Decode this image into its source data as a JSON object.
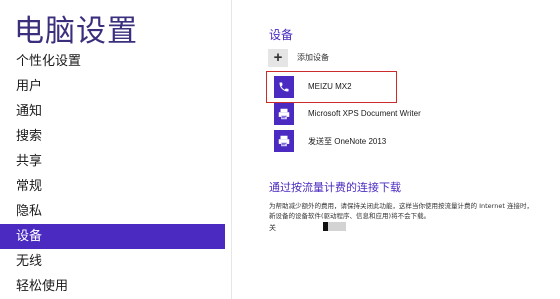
{
  "sidebar": {
    "title": "电脑设置",
    "items": [
      {
        "label": "个性化设置"
      },
      {
        "label": "用户"
      },
      {
        "label": "通知"
      },
      {
        "label": "搜索"
      },
      {
        "label": "共享"
      },
      {
        "label": "常规"
      },
      {
        "label": "隐私"
      },
      {
        "label": "设备"
      },
      {
        "label": "无线"
      },
      {
        "label": "轻松使用"
      }
    ],
    "active_item": "设备"
  },
  "devices": {
    "section_title": "设备",
    "add_label": "添加设备",
    "list": [
      {
        "name": "MEIZU MX2",
        "icon": "phone-icon"
      },
      {
        "name": "Microsoft XPS Document Writer",
        "icon": "printer-icon"
      },
      {
        "name": "发送至 OneNote 2013",
        "icon": "printer-icon"
      }
    ]
  },
  "metered": {
    "title": "通过按流量计费的连接下载",
    "description": "为帮助减少额外的费用，请保持关闭此功能，这样当你使用按流量计费的 Internet 连接时，新设备的设备软件(驱动程序、信息和应用)将不会下载。",
    "toggle_state": "关"
  },
  "colors": {
    "accent": "#4a2ac0",
    "highlight_border": "#cc2b2b"
  }
}
